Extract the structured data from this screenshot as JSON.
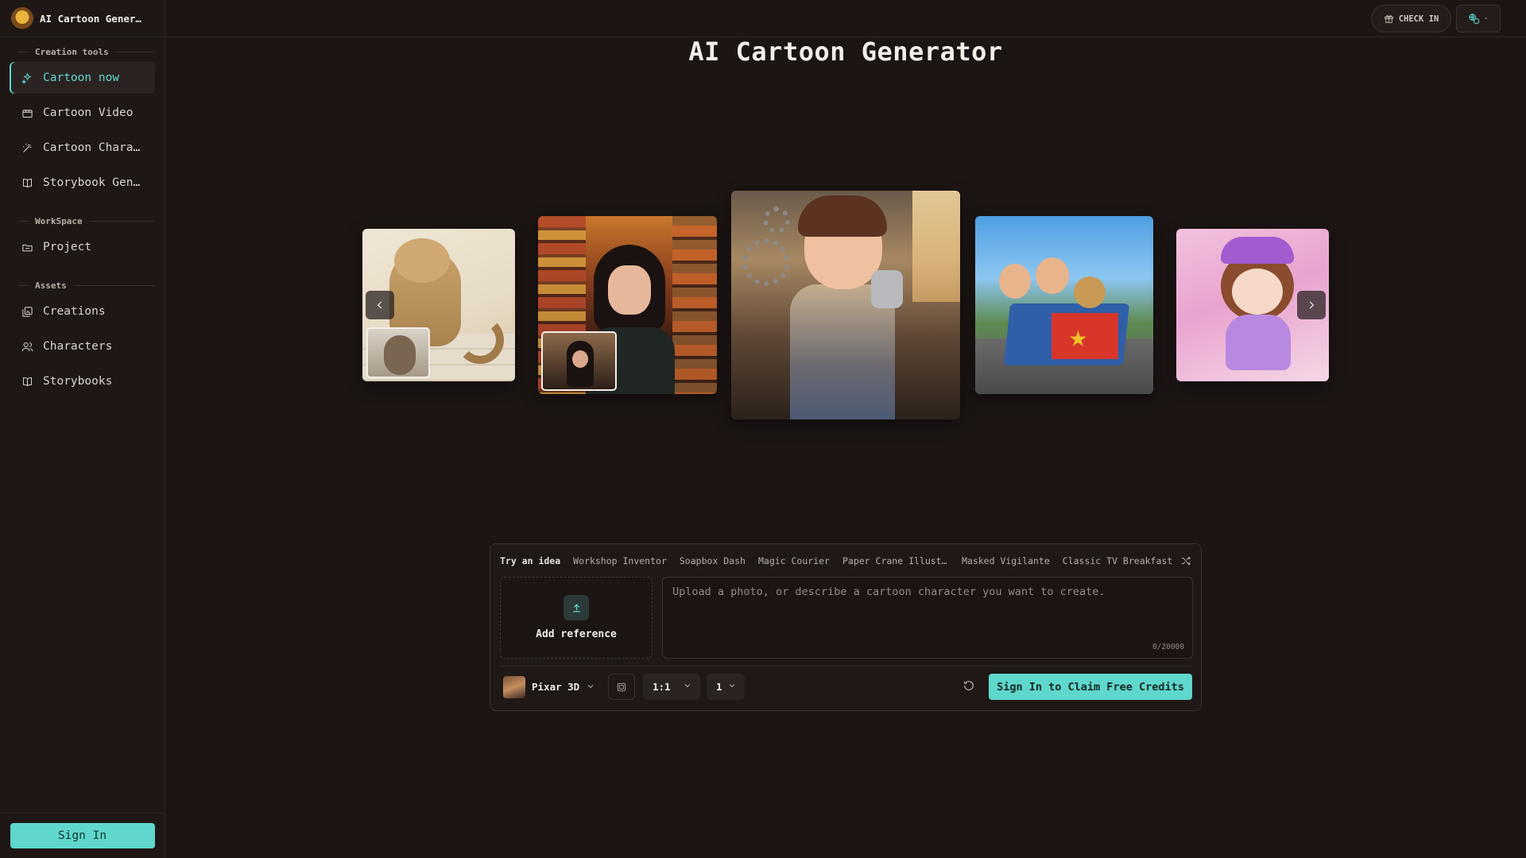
{
  "app": {
    "title": "AI Cartoon Generator"
  },
  "sidebar": {
    "brand": "AI Cartoon Generator",
    "sections": [
      {
        "label": "Creation tools"
      },
      {
        "label": "WorkSpace"
      },
      {
        "label": "Assets"
      }
    ],
    "items": [
      {
        "label": "Cartoon now",
        "icon": "sparkles-icon",
        "active": true
      },
      {
        "label": "Cartoon Video",
        "icon": "video-icon"
      },
      {
        "label": "Cartoon Character",
        "icon": "magic-wand-icon"
      },
      {
        "label": "Storybook Generator",
        "icon": "book-icon"
      },
      {
        "label": "Project",
        "icon": "folder-icon"
      },
      {
        "label": "Creations",
        "icon": "gallery-icon"
      },
      {
        "label": "Characters",
        "icon": "users-icon"
      },
      {
        "label": "Storybooks",
        "icon": "book-icon"
      }
    ],
    "signin_label": "Sign In"
  },
  "topbar": {
    "checkin_label": "CHECK IN",
    "lang_caret": "-"
  },
  "main": {
    "page_title": "AI Cartoon Generator"
  },
  "prompt_panel": {
    "ideas_label": "Try an idea",
    "ideas": [
      "Workshop Inventor",
      "Soapbox Dash",
      "Magic Courier",
      "Paper Crane Illustration",
      "Masked Vigilante",
      "Classic TV Breakfast"
    ],
    "reference_label": "Add reference",
    "placeholder": "Upload a photo, or describe a cartoon character you want to create.",
    "value": "",
    "counter": "0/20000",
    "style_label": "Pixar 3D",
    "ratio": "1:1",
    "count": "1",
    "claim_label": "Sign In to Claim Free Credits"
  },
  "colors": {
    "accent": "#5fd7cc",
    "background": "#1c1514",
    "sidebar": "#1e1716"
  }
}
